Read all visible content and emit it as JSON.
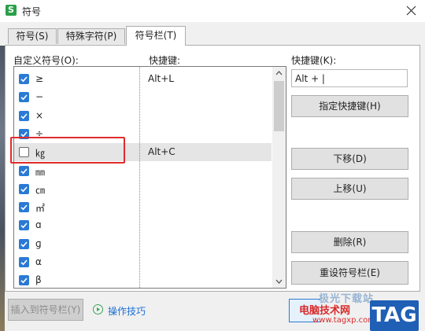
{
  "window": {
    "title": "符号",
    "app_icon_letter": "S"
  },
  "tabs": [
    {
      "label": "符号(S)",
      "active": false
    },
    {
      "label": "特殊字符(P)",
      "active": false
    },
    {
      "label": "符号栏(T)",
      "active": true
    }
  ],
  "panel": {
    "custom_symbols_label": "自定义符号(O):",
    "hotkey_col_label": "快捷键:",
    "rows": [
      {
        "symbol": "≥",
        "hotkey": "Alt+L",
        "checked": true,
        "selected": false
      },
      {
        "symbol": "−",
        "hotkey": "",
        "checked": true,
        "selected": false
      },
      {
        "symbol": "×",
        "hotkey": "",
        "checked": true,
        "selected": false
      },
      {
        "symbol": "÷",
        "hotkey": "",
        "checked": true,
        "selected": false
      },
      {
        "symbol": "㎏",
        "hotkey": "Alt+C",
        "checked": false,
        "selected": true
      },
      {
        "symbol": "㎜",
        "hotkey": "",
        "checked": true,
        "selected": false
      },
      {
        "symbol": "㎝",
        "hotkey": "",
        "checked": true,
        "selected": false
      },
      {
        "symbol": "㎡",
        "hotkey": "",
        "checked": true,
        "selected": false
      },
      {
        "symbol": "ɑ",
        "hotkey": "",
        "checked": true,
        "selected": false
      },
      {
        "symbol": "ɡ",
        "hotkey": "",
        "checked": true,
        "selected": false
      },
      {
        "symbol": "α",
        "hotkey": "",
        "checked": true,
        "selected": false
      },
      {
        "symbol": "β",
        "hotkey": "",
        "checked": true,
        "selected": false
      }
    ],
    "hotkey_label": "快捷键(K):",
    "hotkey_value": "Alt + |",
    "assign_hotkey_button": "指定快捷键(H)",
    "move_down_button": "下移(D)",
    "move_up_button": "上移(U)",
    "delete_button": "删除(R)",
    "reset_button": "重设符号栏(E)"
  },
  "footer": {
    "insert_button": "插入到符号栏(Y)",
    "tips_link": "操作技巧"
  },
  "watermark": {
    "line1": "极光下载站",
    "line2": "电脑技术网",
    "line3": "www.tagxp.com",
    "badge": "TAG"
  },
  "colors": {
    "accent": "#2a7ad5",
    "highlight_border": "#e02b2b"
  }
}
